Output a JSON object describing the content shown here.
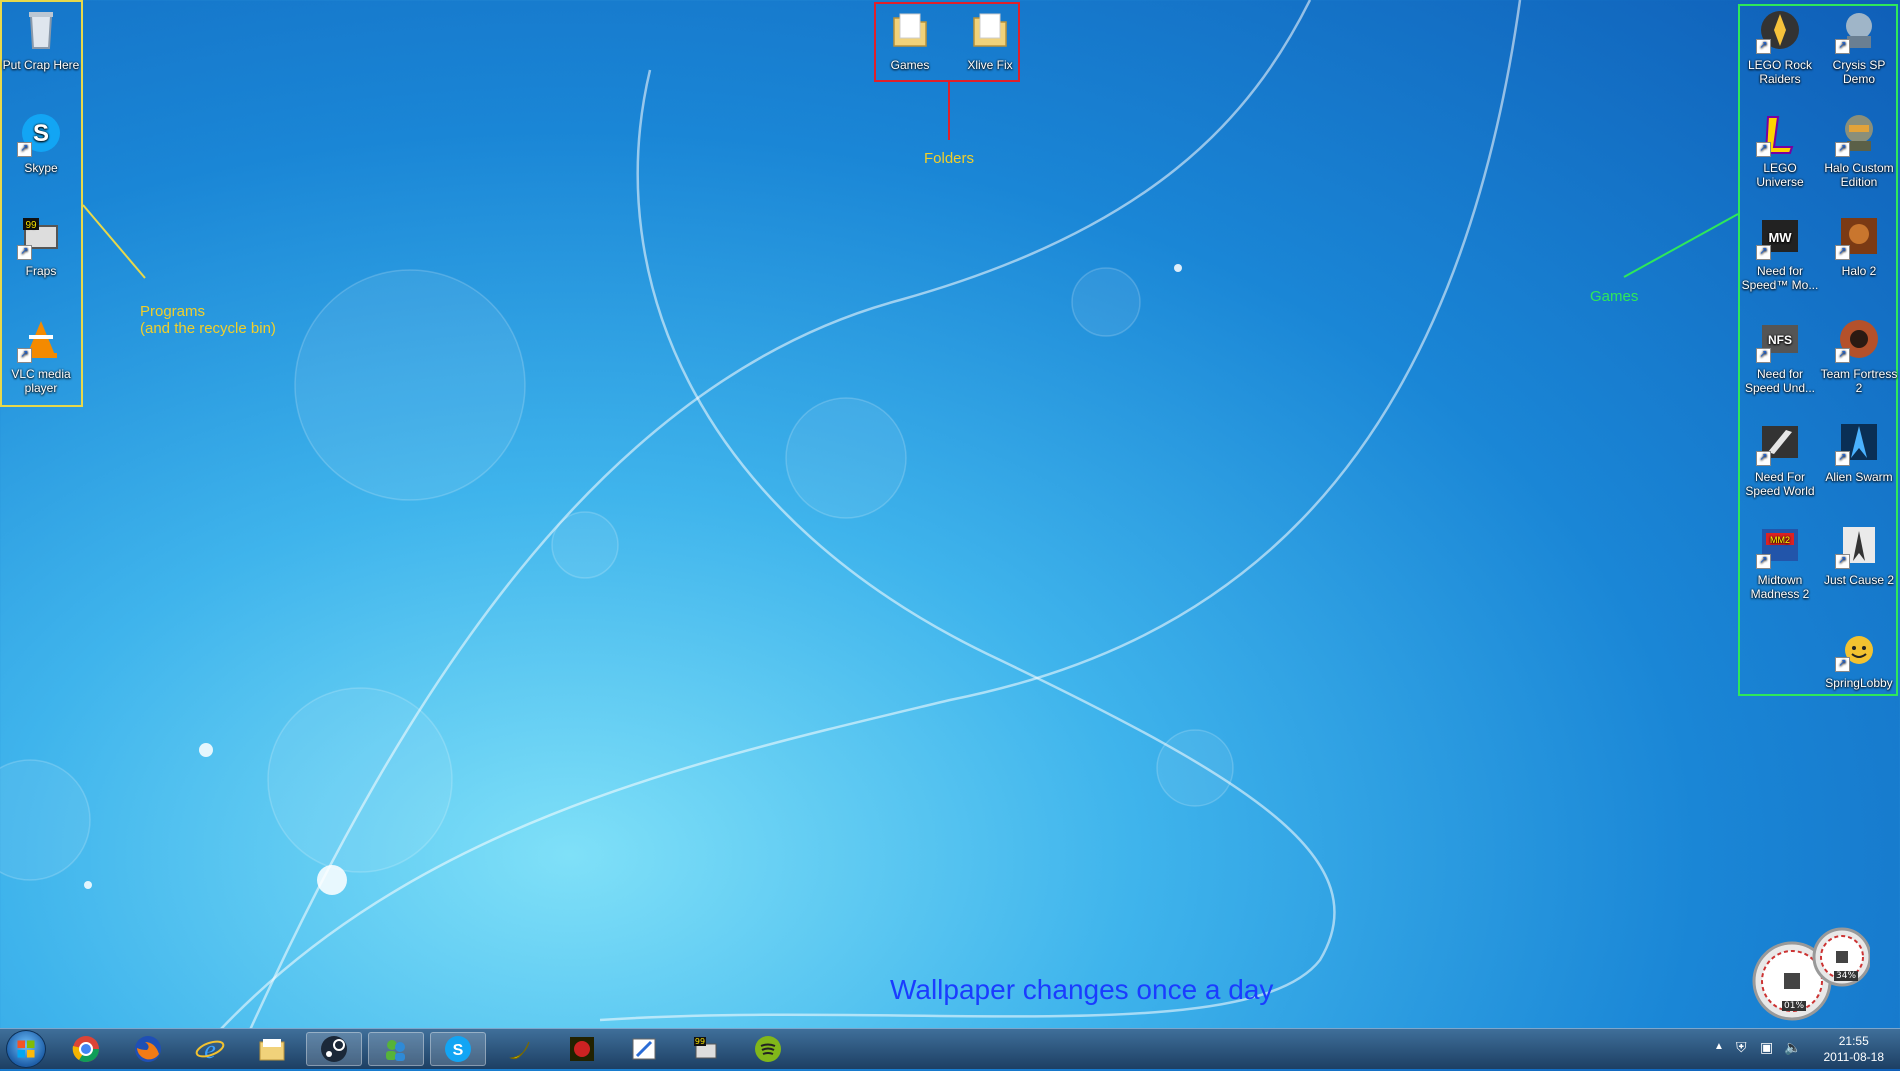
{
  "desktop": {
    "left_icons": [
      {
        "label": "Put Crap Here",
        "icon": "recycle-bin-icon"
      },
      {
        "label": "Skype",
        "icon": "skype-icon"
      },
      {
        "label": "Fraps",
        "icon": "fraps-icon"
      },
      {
        "label": "VLC media player",
        "icon": "vlc-icon"
      }
    ],
    "folder_icons": [
      {
        "label": "Games",
        "icon": "folder-icon"
      },
      {
        "label": "Xlive Fix",
        "icon": "folder-icon"
      }
    ],
    "game_icons": [
      {
        "label": "LEGO Rock Raiders",
        "icon": "lego-rock-raiders-icon"
      },
      {
        "label": "Crysis SP Demo",
        "icon": "crysis-icon"
      },
      {
        "label": "LEGO Universe",
        "icon": "lego-universe-icon"
      },
      {
        "label": "Halo Custom Edition",
        "icon": "halo-ce-icon"
      },
      {
        "label": "Need for Speed™ Mo...",
        "icon": "nfs-mw-icon"
      },
      {
        "label": "Halo 2",
        "icon": "halo2-icon"
      },
      {
        "label": "Need for Speed Und...",
        "icon": "nfs-underground-icon"
      },
      {
        "label": "Team Fortress 2",
        "icon": "tf2-icon"
      },
      {
        "label": "Need For Speed World",
        "icon": "nfs-world-icon"
      },
      {
        "label": "Alien Swarm",
        "icon": "alien-swarm-icon"
      },
      {
        "label": "Midtown Madness 2",
        "icon": "midtown-madness-icon"
      },
      {
        "label": "Just Cause 2",
        "icon": "just-cause-icon"
      },
      {
        "label": "SpringLobby",
        "icon": "springlobby-icon"
      }
    ]
  },
  "annotations": {
    "folders": "Folders",
    "programs_line1": "Programs",
    "programs_line2": "(and the recycle bin)",
    "games": "Games",
    "wallpaper": "Wallpaper changes once a day"
  },
  "colors": {
    "folders_box": "#e0202a",
    "programs_box": "#e8d84a",
    "games_box": "#2ee85a",
    "wallpaper_text": "#1a3cff"
  },
  "gadget": {
    "cpu": "01%",
    "ram": "34%"
  },
  "taskbar": {
    "start": "start-button-icon",
    "apps": [
      "chrome-icon",
      "firefox-icon",
      "ie-icon",
      "explorer-icon",
      "steam-icon",
      "messenger-icon",
      "skype-icon",
      "banana-icon",
      "game-icon",
      "paint-icon",
      "fraps-icon",
      "spotify-icon"
    ],
    "clock_time": "21:55",
    "clock_date": "2011-08-18"
  }
}
